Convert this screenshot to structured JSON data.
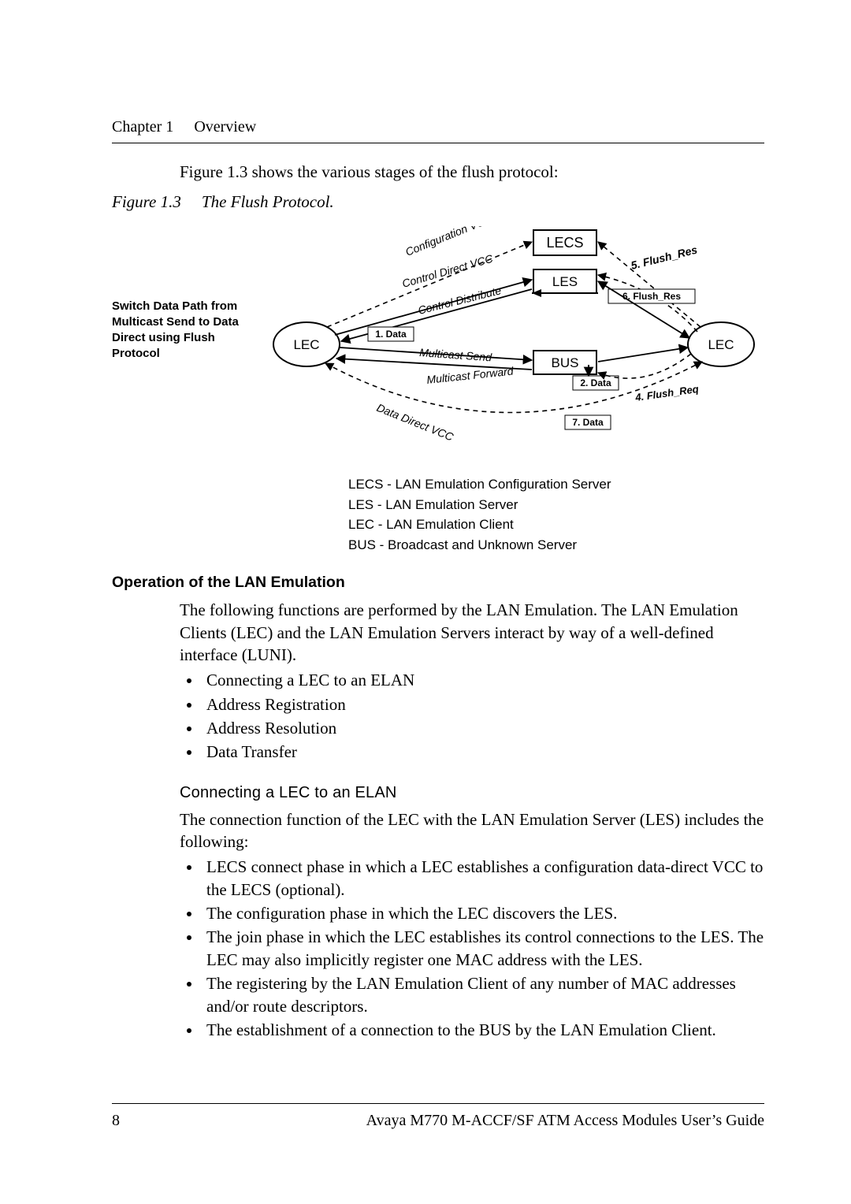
{
  "runhead": {
    "chapter": "Chapter 1",
    "title": "Overview"
  },
  "intro_line": "Figure 1.3 shows the various stages of the flush protocol:",
  "figure": {
    "number": "Figure 1.3",
    "title": "The Flush Protocol.",
    "side_caption": "Switch Data Path from Multicast Send to Data Direct using Flush Protocol",
    "nodes": {
      "lecs": "LECS",
      "les": "LES",
      "bus": "BUS",
      "lec_left": "LEC",
      "lec_right": "LEC"
    },
    "edges": {
      "config_vcc": "Configuration VCC",
      "control_direct": "Control Direct VCC",
      "control_distribute": "Control Distribute",
      "multicast_send": "Multicast Send",
      "multicast_forward": "Multicast Forward",
      "data_direct": "Data Direct VCC",
      "d1": "1. Data",
      "d2": "2. Data",
      "d7": "7. Data",
      "fr4": "4. Flush_Req",
      "fr5": "5. Flush_Res",
      "fr6": "6. Flush_Res"
    },
    "legend": {
      "lecs": "LECS - LAN Emulation Configuration Server",
      "les": "LES - LAN Emulation Server",
      "lec": "LEC - LAN Emulation Client",
      "bus": "BUS - Broadcast and Unknown Server"
    }
  },
  "section_h2": "Operation of the LAN Emulation",
  "section_p": "The following functions are performed by the LAN Emulation. The LAN Emulation Clients (LEC) and the LAN Emulation Servers interact by way of a well-defined interface (LUNI).",
  "section_bullets": [
    "Connecting a LEC to an ELAN",
    "Address Registration",
    "Address Resolution",
    "Data Transfer"
  ],
  "sub_h3": "Connecting a LEC to an ELAN",
  "sub_p": "The connection function of the LEC with the LAN Emulation Server (LES) includes the following:",
  "sub_bullets": [
    "LECS connect phase in which a LEC establishes a configuration data-direct VCC to the LECS (optional).",
    "The configuration phase in which the LEC discovers the LES.",
    "The join phase in which the LEC establishes its control connections to the LES. The LEC may also implicitly register one MAC address with the LES.",
    "The registering by the LAN Emulation Client of any number of MAC addresses and/or route descriptors.",
    "The establishment of a connection to the BUS by the LAN Emulation Client."
  ],
  "footer": {
    "page": "8",
    "book": "Avaya M770 M-ACCF/SF ATM Access Modules User’s Guide"
  }
}
